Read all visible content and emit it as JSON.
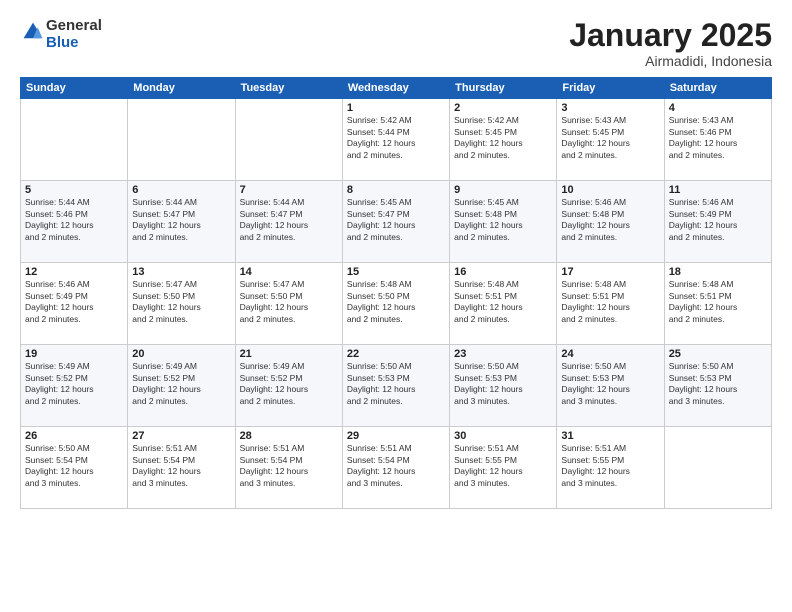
{
  "logo": {
    "general": "General",
    "blue": "Blue"
  },
  "header": {
    "month": "January 2025",
    "location": "Airmadidi, Indonesia"
  },
  "weekdays": [
    "Sunday",
    "Monday",
    "Tuesday",
    "Wednesday",
    "Thursday",
    "Friday",
    "Saturday"
  ],
  "weeks": [
    [
      {
        "day": "",
        "info": ""
      },
      {
        "day": "",
        "info": ""
      },
      {
        "day": "",
        "info": ""
      },
      {
        "day": "1",
        "info": "Sunrise: 5:42 AM\nSunset: 5:44 PM\nDaylight: 12 hours\nand 2 minutes."
      },
      {
        "day": "2",
        "info": "Sunrise: 5:42 AM\nSunset: 5:45 PM\nDaylight: 12 hours\nand 2 minutes."
      },
      {
        "day": "3",
        "info": "Sunrise: 5:43 AM\nSunset: 5:45 PM\nDaylight: 12 hours\nand 2 minutes."
      },
      {
        "day": "4",
        "info": "Sunrise: 5:43 AM\nSunset: 5:46 PM\nDaylight: 12 hours\nand 2 minutes."
      }
    ],
    [
      {
        "day": "5",
        "info": "Sunrise: 5:44 AM\nSunset: 5:46 PM\nDaylight: 12 hours\nand 2 minutes."
      },
      {
        "day": "6",
        "info": "Sunrise: 5:44 AM\nSunset: 5:47 PM\nDaylight: 12 hours\nand 2 minutes."
      },
      {
        "day": "7",
        "info": "Sunrise: 5:44 AM\nSunset: 5:47 PM\nDaylight: 12 hours\nand 2 minutes."
      },
      {
        "day": "8",
        "info": "Sunrise: 5:45 AM\nSunset: 5:47 PM\nDaylight: 12 hours\nand 2 minutes."
      },
      {
        "day": "9",
        "info": "Sunrise: 5:45 AM\nSunset: 5:48 PM\nDaylight: 12 hours\nand 2 minutes."
      },
      {
        "day": "10",
        "info": "Sunrise: 5:46 AM\nSunset: 5:48 PM\nDaylight: 12 hours\nand 2 minutes."
      },
      {
        "day": "11",
        "info": "Sunrise: 5:46 AM\nSunset: 5:49 PM\nDaylight: 12 hours\nand 2 minutes."
      }
    ],
    [
      {
        "day": "12",
        "info": "Sunrise: 5:46 AM\nSunset: 5:49 PM\nDaylight: 12 hours\nand 2 minutes."
      },
      {
        "day": "13",
        "info": "Sunrise: 5:47 AM\nSunset: 5:50 PM\nDaylight: 12 hours\nand 2 minutes."
      },
      {
        "day": "14",
        "info": "Sunrise: 5:47 AM\nSunset: 5:50 PM\nDaylight: 12 hours\nand 2 minutes."
      },
      {
        "day": "15",
        "info": "Sunrise: 5:48 AM\nSunset: 5:50 PM\nDaylight: 12 hours\nand 2 minutes."
      },
      {
        "day": "16",
        "info": "Sunrise: 5:48 AM\nSunset: 5:51 PM\nDaylight: 12 hours\nand 2 minutes."
      },
      {
        "day": "17",
        "info": "Sunrise: 5:48 AM\nSunset: 5:51 PM\nDaylight: 12 hours\nand 2 minutes."
      },
      {
        "day": "18",
        "info": "Sunrise: 5:48 AM\nSunset: 5:51 PM\nDaylight: 12 hours\nand 2 minutes."
      }
    ],
    [
      {
        "day": "19",
        "info": "Sunrise: 5:49 AM\nSunset: 5:52 PM\nDaylight: 12 hours\nand 2 minutes."
      },
      {
        "day": "20",
        "info": "Sunrise: 5:49 AM\nSunset: 5:52 PM\nDaylight: 12 hours\nand 2 minutes."
      },
      {
        "day": "21",
        "info": "Sunrise: 5:49 AM\nSunset: 5:52 PM\nDaylight: 12 hours\nand 2 minutes."
      },
      {
        "day": "22",
        "info": "Sunrise: 5:50 AM\nSunset: 5:53 PM\nDaylight: 12 hours\nand 2 minutes."
      },
      {
        "day": "23",
        "info": "Sunrise: 5:50 AM\nSunset: 5:53 PM\nDaylight: 12 hours\nand 3 minutes."
      },
      {
        "day": "24",
        "info": "Sunrise: 5:50 AM\nSunset: 5:53 PM\nDaylight: 12 hours\nand 3 minutes."
      },
      {
        "day": "25",
        "info": "Sunrise: 5:50 AM\nSunset: 5:53 PM\nDaylight: 12 hours\nand 3 minutes."
      }
    ],
    [
      {
        "day": "26",
        "info": "Sunrise: 5:50 AM\nSunset: 5:54 PM\nDaylight: 12 hours\nand 3 minutes."
      },
      {
        "day": "27",
        "info": "Sunrise: 5:51 AM\nSunset: 5:54 PM\nDaylight: 12 hours\nand 3 minutes."
      },
      {
        "day": "28",
        "info": "Sunrise: 5:51 AM\nSunset: 5:54 PM\nDaylight: 12 hours\nand 3 minutes."
      },
      {
        "day": "29",
        "info": "Sunrise: 5:51 AM\nSunset: 5:54 PM\nDaylight: 12 hours\nand 3 minutes."
      },
      {
        "day": "30",
        "info": "Sunrise: 5:51 AM\nSunset: 5:55 PM\nDaylight: 12 hours\nand 3 minutes."
      },
      {
        "day": "31",
        "info": "Sunrise: 5:51 AM\nSunset: 5:55 PM\nDaylight: 12 hours\nand 3 minutes."
      },
      {
        "day": "",
        "info": ""
      }
    ]
  ]
}
